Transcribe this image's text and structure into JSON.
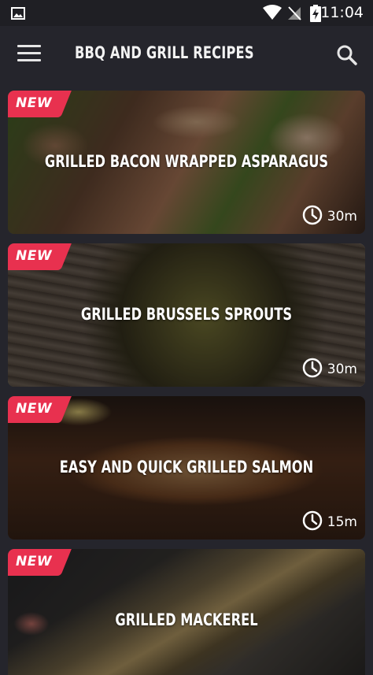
{
  "status_bar": {
    "time": "11:04",
    "icons": [
      "image-icon",
      "wifi-icon",
      "no-signal-icon",
      "battery-charging-icon"
    ]
  },
  "app_bar": {
    "title": "BBQ AND GRILL RECIPES",
    "menu_icon": "hamburger-menu-icon",
    "search_icon": "search-icon"
  },
  "recipes": [
    {
      "title": "GRILLED BACON WRAPPED ASPARAGUS",
      "badge": "NEW",
      "time": "30m"
    },
    {
      "title": "GRILLED BRUSSELS SPROUTS",
      "badge": "NEW",
      "time": "30m"
    },
    {
      "title": "EASY AND QUICK GRILLED SALMON",
      "badge": "NEW",
      "time": "15m"
    },
    {
      "title": "GRILLED MACKEREL",
      "badge": "NEW",
      "time": ""
    }
  ],
  "colors": {
    "background": "#25252c",
    "status_bar": "#1f1f24",
    "badge": "#e8314f"
  }
}
